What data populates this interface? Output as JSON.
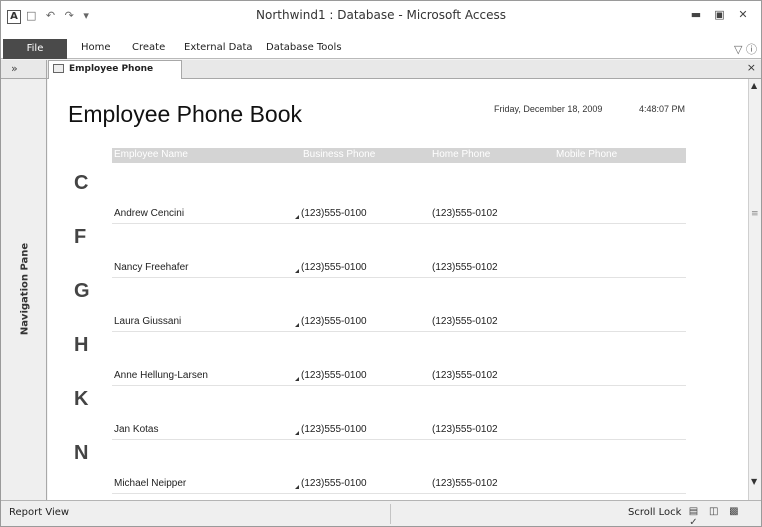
{
  "window": {
    "title": "Northwind1 : Database  -  Microsoft Access",
    "app_icon_letter": "A",
    "qat_icons": [
      "save-icon",
      "undo-icon",
      "redo-icon",
      "customize-qat-icon"
    ],
    "controls": [
      "minimize-icon",
      "maximize-icon",
      "close-icon"
    ]
  },
  "ribbon": {
    "file": "File",
    "tabs": [
      "Home",
      "Create",
      "External Data",
      "Database Tools"
    ]
  },
  "doc": {
    "shutter": "»",
    "tab_label": "Employee Phone Book",
    "close": "×"
  },
  "navpane": {
    "label": "Navigation Pane"
  },
  "report": {
    "title": "Employee Phone Book",
    "date": "Friday, December 18, 2009",
    "time": "4:48:07 PM",
    "columns": [
      "Employee Name",
      "Business Phone",
      "Home Phone",
      "Mobile Phone"
    ],
    "groups": [
      {
        "letter": "C",
        "name": "Andrew Cencini",
        "business": "(123)555-0100",
        "home": "(123)555-0102"
      },
      {
        "letter": "F",
        "name": "Nancy Freehafer",
        "business": "(123)555-0100",
        "home": "(123)555-0102"
      },
      {
        "letter": "G",
        "name": "Laura Giussani",
        "business": "(123)555-0100",
        "home": "(123)555-0102"
      },
      {
        "letter": "H",
        "name": "Anne Hellung-Larsen",
        "business": "(123)555-0100",
        "home": "(123)555-0102"
      },
      {
        "letter": "K",
        "name": "Jan Kotas",
        "business": "(123)555-0100",
        "home": "(123)555-0102"
      },
      {
        "letter": "N",
        "name": "Michael Neipper",
        "business": "(123)555-0100",
        "home": "(123)555-0102"
      }
    ]
  },
  "statusbar": {
    "view": "Report View",
    "scroll_lock": "Scroll Lock",
    "view_buttons": [
      "report-view-icon",
      "print-preview-icon",
      "layout-view-icon",
      "design-view-icon"
    ]
  }
}
